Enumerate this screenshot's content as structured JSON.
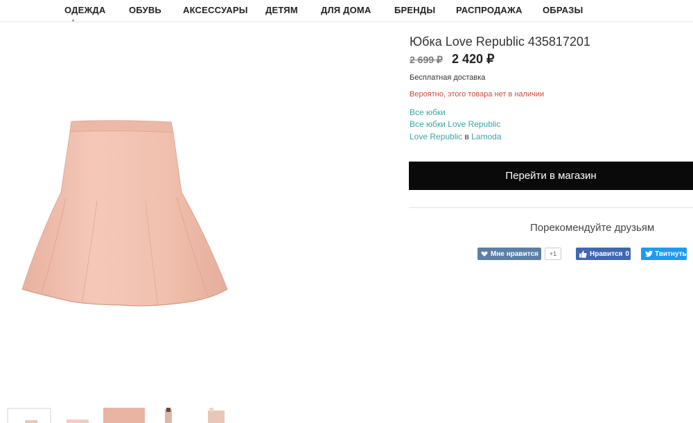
{
  "nav": {
    "items": [
      "ОДЕЖДА",
      "ОБУВЬ",
      "АКСЕССУАРЫ",
      "ДЕТЯМ",
      "ДЛЯ ДОМА",
      "БРЕНДЫ",
      "РАСПРОДАЖА",
      "ОБРАЗЫ"
    ]
  },
  "product": {
    "title": "Юбка Love Republic 435817201",
    "price_old": "2 699 ₽",
    "price_new": "2 420 ₽",
    "delivery": "Бесплатная доставка",
    "stock_warning": "Вероятно, этого товара нет в наличии",
    "skirt_color": "#f2c3b3"
  },
  "links": {
    "all_skirts": "Все юбки",
    "all_brand_skirts": "Все юбки Love Republic",
    "brand": "Love Republic",
    "in_word": " в ",
    "store": "Lamoda"
  },
  "actions": {
    "go_to_store": "Перейти в магазин",
    "recommend": "Порекомендуйте друзьям"
  },
  "social": {
    "vk_label": "Мне нравится",
    "vk_count": "+1",
    "fb_label": "Нравится",
    "fb_count": "0",
    "tw_label": "Твитнуть"
  },
  "colors": {
    "accent_link": "#3aa6a6",
    "warning": "#d04a3b",
    "button_bg": "#0a0a0a"
  }
}
